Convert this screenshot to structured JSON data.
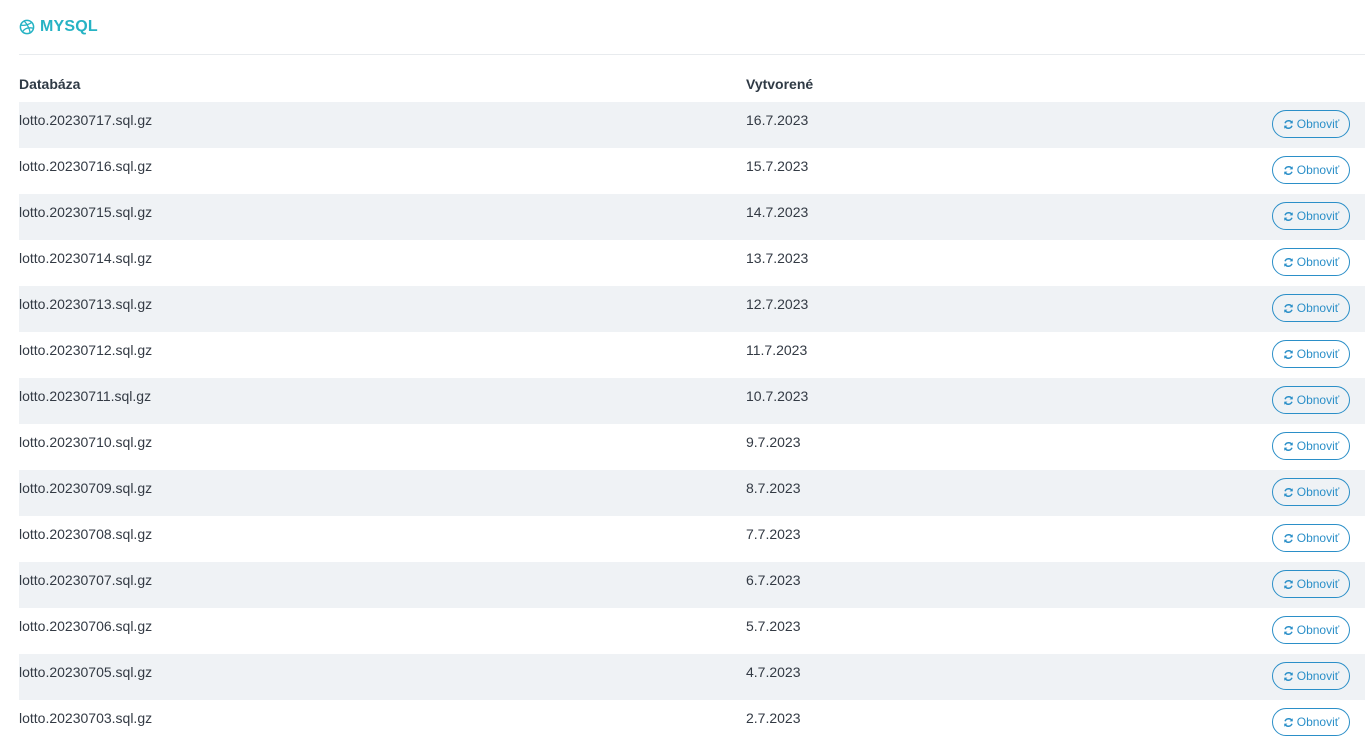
{
  "section": {
    "title": "MYSQL",
    "icon": "dribbble-icon",
    "accent_color": "#26b3c4"
  },
  "table": {
    "columns": [
      "Databáza",
      "Vytvorené"
    ],
    "action_label": "Obnoviť",
    "action_icon": "refresh-icon",
    "rows": [
      {
        "database": "lotto.20230717.sql.gz",
        "created": "16.7.2023"
      },
      {
        "database": "lotto.20230716.sql.gz",
        "created": "15.7.2023"
      },
      {
        "database": "lotto.20230715.sql.gz",
        "created": "14.7.2023"
      },
      {
        "database": "lotto.20230714.sql.gz",
        "created": "13.7.2023"
      },
      {
        "database": "lotto.20230713.sql.gz",
        "created": "12.7.2023"
      },
      {
        "database": "lotto.20230712.sql.gz",
        "created": "11.7.2023"
      },
      {
        "database": "lotto.20230711.sql.gz",
        "created": "10.7.2023"
      },
      {
        "database": "lotto.20230710.sql.gz",
        "created": "9.7.2023"
      },
      {
        "database": "lotto.20230709.sql.gz",
        "created": "8.7.2023"
      },
      {
        "database": "lotto.20230708.sql.gz",
        "created": "7.7.2023"
      },
      {
        "database": "lotto.20230707.sql.gz",
        "created": "6.7.2023"
      },
      {
        "database": "lotto.20230706.sql.gz",
        "created": "5.7.2023"
      },
      {
        "database": "lotto.20230705.sql.gz",
        "created": "4.7.2023"
      },
      {
        "database": "lotto.20230703.sql.gz",
        "created": "2.7.2023"
      }
    ]
  }
}
